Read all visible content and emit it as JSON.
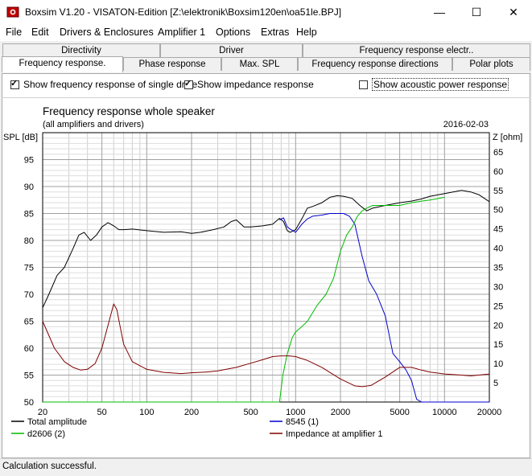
{
  "window": {
    "title": "Boxsim V1.20 - VISATON-Edition [Z:\\elektronik\\Boxsim120en\\oa51le.BPJ]",
    "controls": [
      "—",
      "☐",
      "✕"
    ]
  },
  "menu": [
    "File",
    "Edit",
    "Drivers & Enclosures",
    "Amplifier 1",
    "Options",
    "Extras",
    "Help"
  ],
  "tabs": {
    "row1": [
      "Directivity",
      "Driver",
      "Frequency response electr.."
    ],
    "row2": [
      "Frequency response.",
      "Phase response",
      "Max. SPL",
      "Frequency response directions",
      "Polar plots"
    ],
    "active": "Frequency response."
  },
  "options": {
    "single_drive": {
      "label": "Show frequency response of single drive",
      "checked": true
    },
    "impedance": {
      "label": "Show impedance response",
      "checked": true
    },
    "acoustic_power": {
      "label": "Show acoustic power response",
      "checked": false
    }
  },
  "status": "Calculation successful.",
  "chart_data": {
    "type": "line",
    "title": "Frequency response whole speaker",
    "subtitle": "(all amplifiers and drivers)",
    "date": "2016-02-03",
    "ylabel": "SPL [dB]",
    "y2label": "Z [ohm]",
    "x_scale": "log",
    "xlim": [
      20,
      20000
    ],
    "ylim": [
      50,
      100
    ],
    "y2lim": [
      0,
      70
    ],
    "x_ticks": [
      20,
      50,
      100,
      200,
      500,
      1000,
      2000,
      5000,
      10000,
      20000
    ],
    "x_tick_labels": [
      "20",
      "50",
      "100",
      "200",
      "500",
      "1000",
      "2000",
      "5000",
      "10000",
      "20000"
    ],
    "y_ticks": [
      50,
      55,
      60,
      65,
      70,
      75,
      80,
      85,
      90,
      95
    ],
    "y2_ticks": [
      5,
      10,
      15,
      20,
      25,
      30,
      35,
      40,
      45,
      50,
      55,
      60,
      65
    ],
    "grid": true,
    "legend_position": "bottom",
    "series": [
      {
        "name": "Total amplitude",
        "axis": "left",
        "color": "#000000",
        "x": [
          20,
          22,
          25,
          28,
          32,
          35,
          38,
          42,
          46,
          50,
          55,
          60,
          65,
          70,
          80,
          100,
          130,
          170,
          200,
          230,
          280,
          330,
          370,
          400,
          450,
          500,
          600,
          700,
          780,
          830,
          880,
          920,
          1000,
          1100,
          1200,
          1300,
          1500,
          1700,
          1900,
          2100,
          2400,
          2700,
          3000,
          3300,
          4000,
          5000,
          6000,
          7000,
          8000,
          10000,
          12000,
          13000,
          15000,
          17000,
          20000
        ],
        "y": [
          67.5,
          70,
          73.5,
          75,
          78.5,
          81,
          81.5,
          80,
          81,
          82.5,
          83.3,
          82.7,
          82,
          82,
          82.1,
          81.8,
          81.5,
          81.6,
          81.3,
          81.5,
          82,
          82.5,
          83.5,
          83.8,
          82.5,
          82.5,
          82.7,
          83,
          84.1,
          83.5,
          81.8,
          81.5,
          82,
          84,
          86,
          86.3,
          87,
          88,
          88.3,
          88.2,
          87.8,
          86.5,
          85.5,
          86,
          86.5,
          87,
          87.3,
          87.7,
          88.2,
          88.7,
          89.1,
          89.3,
          89,
          88.5,
          87.2
        ]
      },
      {
        "name": "8545 (1)",
        "axis": "left",
        "color": "#0000cc",
        "x": [
          780,
          830,
          880,
          930,
          1000,
          1100,
          1200,
          1300,
          1500,
          1700,
          1900,
          2100,
          2300,
          2500,
          2800,
          3100,
          3500,
          4000,
          4500,
          5000,
          5500,
          6000,
          6500,
          7000,
          10000,
          20000
        ],
        "y": [
          83.8,
          84.2,
          82.5,
          82,
          81.5,
          83,
          84,
          84.5,
          84.7,
          85,
          85,
          85,
          84.5,
          83,
          77,
          72.5,
          70,
          66,
          59,
          57.5,
          56,
          54,
          50.5,
          50,
          50,
          50
        ]
      },
      {
        "name": "d2606 (2)",
        "axis": "left",
        "color": "#00bb00",
        "x": [
          20,
          700,
          780,
          820,
          880,
          950,
          1000,
          1100,
          1200,
          1400,
          1600,
          1800,
          2000,
          2200,
          2400,
          2600,
          2800,
          3000,
          3300,
          4000,
          5000,
          6000,
          7000,
          8000,
          10000
        ],
        "y": [
          50,
          50,
          50,
          55,
          59,
          62,
          63,
          64,
          65,
          68,
          70,
          73,
          78,
          81,
          82.5,
          84.5,
          85.5,
          86,
          86.5,
          86.5,
          86.5,
          87,
          87.3,
          87.5,
          88
        ]
      },
      {
        "name": "Impedance at amplifier 1",
        "axis": "right",
        "color": "#800000",
        "x": [
          20,
          24,
          28,
          32,
          36,
          40,
          45,
          50,
          55,
          60,
          63,
          66,
          70,
          80,
          100,
          130,
          170,
          200,
          250,
          300,
          400,
          500,
          600,
          700,
          800,
          900,
          1000,
          1200,
          1500,
          2000,
          2500,
          2800,
          3200,
          4000,
          5000,
          6000,
          7000,
          8000,
          10000,
          13000,
          15000,
          20000
        ],
        "y": [
          21,
          14,
          10.5,
          9,
          8.3,
          8.5,
          10,
          14,
          20,
          25.5,
          24,
          20,
          15,
          10.5,
          8.5,
          7.7,
          7.4,
          7.6,
          7.8,
          8.1,
          9,
          10.1,
          11,
          11.8,
          12,
          12,
          11.8,
          10.8,
          9,
          6,
          4.2,
          4,
          4.3,
          6.5,
          9,
          9,
          8.3,
          7.8,
          7.3,
          7,
          6.8,
          7.3
        ]
      }
    ]
  }
}
